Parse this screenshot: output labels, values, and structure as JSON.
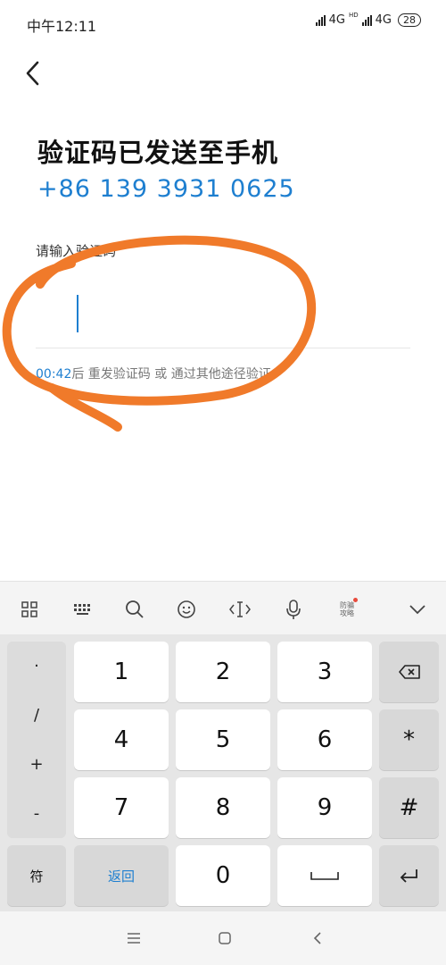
{
  "status_bar": {
    "time": "中午12:11",
    "network1": "4G",
    "hd": "HD",
    "network2": "4G",
    "battery": "28"
  },
  "header": {
    "title": "验证码已发送至手机",
    "phone": "+86 139 3931 0625"
  },
  "form": {
    "label": "请输入验证码",
    "timer": "00:42",
    "resend_text": "后 重发验证码 或 通过其他途径验证"
  },
  "keyboard": {
    "side_keys": [
      "·",
      "/",
      "+",
      "-"
    ],
    "keys": {
      "k1": "1",
      "k2": "2",
      "k3": "3",
      "k4": "4",
      "k5": "5",
      "k6": "6",
      "k7": "7",
      "k8": "8",
      "k9": "9",
      "k0": "0",
      "star": "*",
      "hash": "#",
      "symbol": "符",
      "return": "返回"
    },
    "toolbar_anti_fraud": "防骗\n攻略"
  },
  "colors": {
    "accent": "#1e7fd0",
    "annotation": "#f07a2a"
  }
}
